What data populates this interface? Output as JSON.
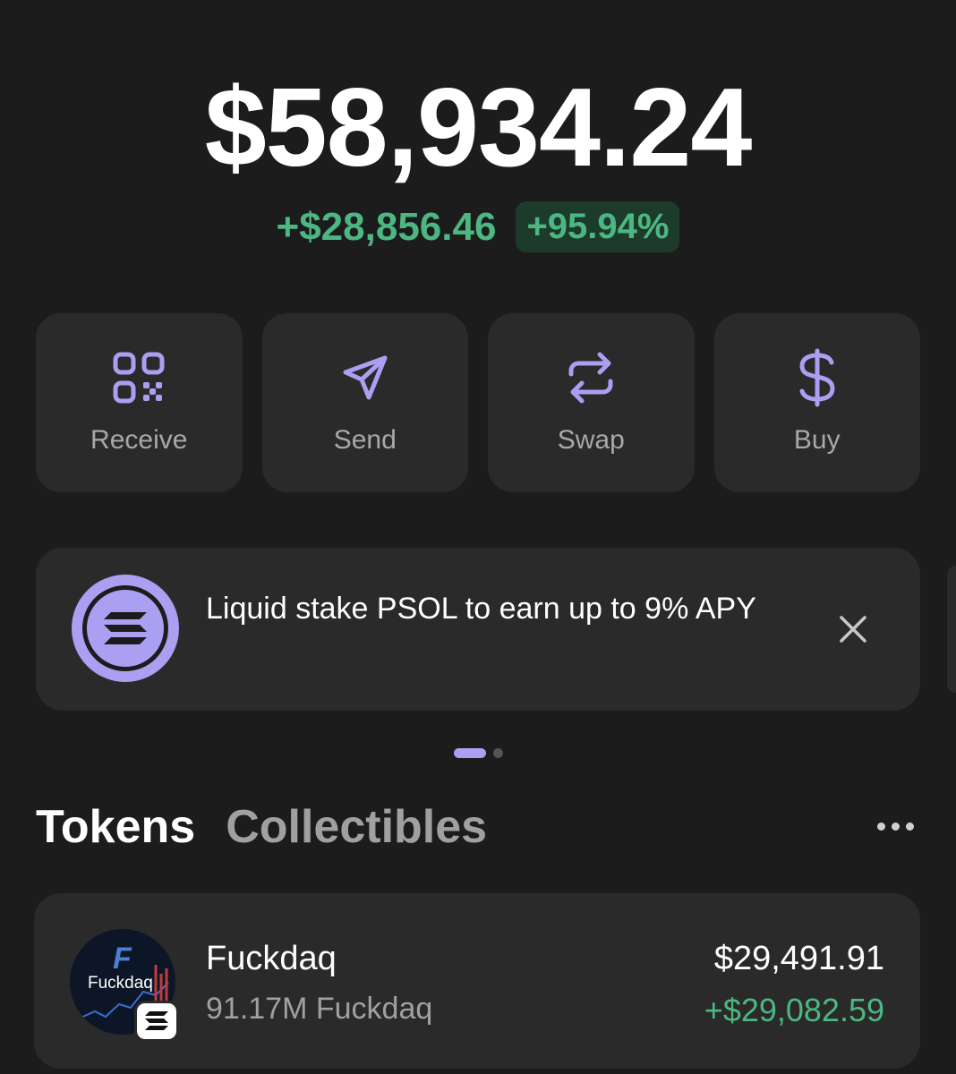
{
  "portfolio": {
    "balance": "$58,934.24",
    "change_amount": "+$28,856.46",
    "change_percent": "+95.94%"
  },
  "colors": {
    "accent": "#ab9ff2",
    "positive": "#4cb782",
    "card": "#2a2a2a",
    "background": "#1c1c1c"
  },
  "actions": [
    {
      "label": "Receive",
      "icon": "qr-code-icon"
    },
    {
      "label": "Send",
      "icon": "paper-plane-icon"
    },
    {
      "label": "Swap",
      "icon": "swap-arrows-icon"
    },
    {
      "label": "Buy",
      "icon": "dollar-icon"
    }
  ],
  "promo": {
    "text": "Liquid stake PSOL to earn up to 9% APY",
    "icon": "solana-logo-icon",
    "close_icon": "close-icon"
  },
  "pager": {
    "pages": 2,
    "active": 1
  },
  "tabs": {
    "tokens": "Tokens",
    "collectibles": "Collectibles",
    "more_icon": "more-dots-icon"
  },
  "tokens": [
    {
      "name": "Fuckdaq",
      "amount": "91.17M Fuckdaq",
      "value": "$29,491.91",
      "change": "+$29,082.59",
      "logo_text": "Fuckdaq",
      "logo_letter": "F"
    }
  ]
}
